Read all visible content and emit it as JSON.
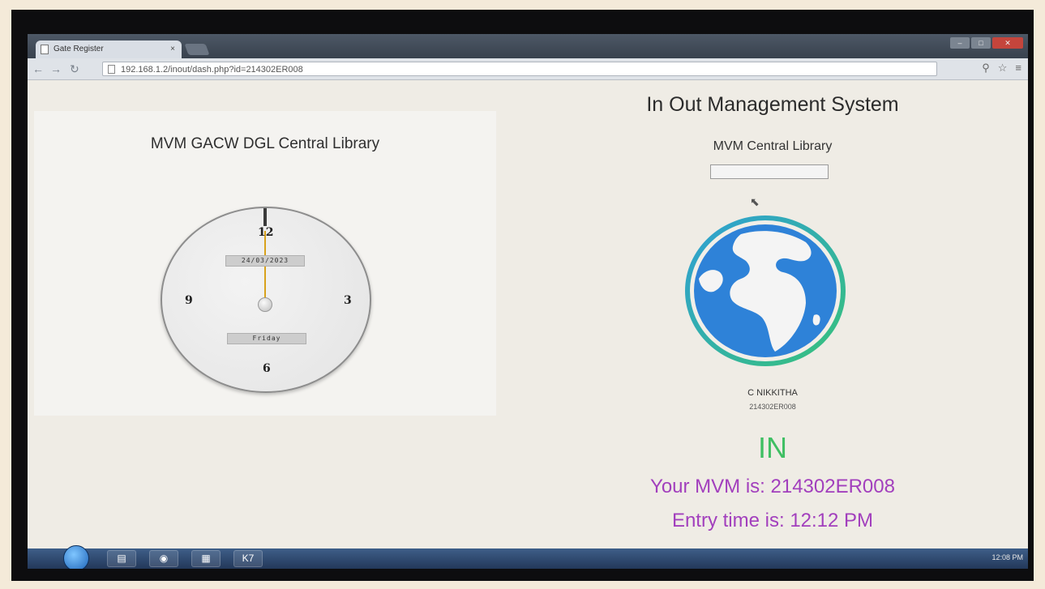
{
  "browser": {
    "tab_title": "Gate Register",
    "tab_close": "×",
    "url": "192.168.1.2/inout/dash.php?id=214302ER008"
  },
  "clock_panel": {
    "title": "MVM GACW DGL Central Library",
    "numerals": {
      "twelve": "12",
      "three": "3",
      "six": "6",
      "nine": "9"
    },
    "date": "24/03/2023",
    "day": "Friday"
  },
  "main": {
    "title": "In Out Management System",
    "library_name": "MVM Central Library",
    "id_input_value": "",
    "user_name": "C NIKKITHA",
    "user_id": "214302ER008",
    "status": "IN",
    "mvm_message": "Your MVM is: 214302ER008",
    "entry_message": "Entry time is: 12:12 PM"
  },
  "taskbar": {
    "k7_label": "K7",
    "clock": "12:08 PM"
  },
  "colors": {
    "status_in": "#3fbf63",
    "message": "#a23fbd",
    "clock_second_hand": "#d8a21c"
  }
}
